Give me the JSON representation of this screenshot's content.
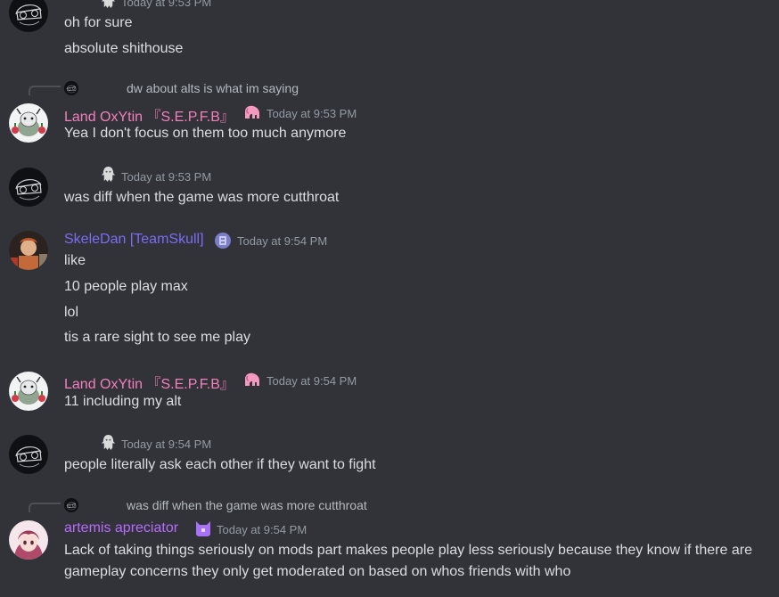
{
  "colors": {
    "background": "#313338",
    "text": "#dbdee1",
    "timestamp": "#949ba4",
    "name_pink": "#f47fbc",
    "name_blue": "#7c6cf4",
    "name_purple": "#b86bff"
  },
  "messages": [
    {
      "id": "m0",
      "timestamp": "Today at 9:53 PM",
      "lines": [
        "oh for sure",
        "absolute shithouse"
      ]
    },
    {
      "id": "m1",
      "reply_text": "dw about alts is what im saying",
      "author": "Land OxYtin 『S.E.P.F.B』",
      "timestamp": "Today at 9:53 PM",
      "lines": [
        "Yea I don't focus on them too much anymore"
      ]
    },
    {
      "id": "m2",
      "timestamp": "Today at 9:53 PM",
      "lines": [
        "was diff when the game was more cutthroat"
      ]
    },
    {
      "id": "m3",
      "author": "SkeleDan [TeamSkull]",
      "timestamp": "Today at 9:54 PM",
      "lines": [
        "like",
        "10 people play max",
        "lol",
        "tis a rare sight to see me play"
      ]
    },
    {
      "id": "m4",
      "author": "Land OxYtin 『S.E.P.F.B』",
      "timestamp": "Today at 9:54 PM",
      "lines": [
        "11 including my alt"
      ]
    },
    {
      "id": "m5",
      "timestamp": "Today at 9:54 PM",
      "lines": [
        "people literally ask each other if they want to fight"
      ]
    },
    {
      "id": "m6",
      "reply_text": "was diff when the game was more cutthroat",
      "author": "artemis apreciator",
      "timestamp": "Today at 9:54 PM",
      "lines": [
        "Lack of taking things seriously on mods part makes people play less seriously because they know if there are",
        "gameplay concerns they only get moderated on based on whos friends with who"
      ]
    }
  ],
  "icons": {
    "avatar_dark": "goggles-sketch-avatar-icon",
    "avatar_cow": "cow-avatar-icon",
    "avatar_skeledan": "skeledan-avatar-icon",
    "avatar_artemis": "anime-girl-avatar-icon",
    "badge_ghost": "ghost-badge-icon",
    "badge_elephant": "elephant-badge-icon",
    "badge_team": "team-badge-icon",
    "badge_cat": "cat-badge-icon"
  }
}
